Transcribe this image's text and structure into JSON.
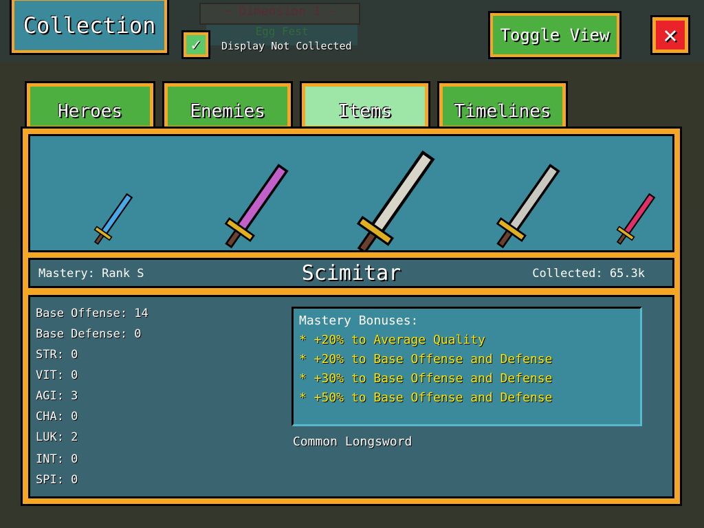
{
  "background": {
    "title": "~ Dimension 1 ~",
    "subtitle": "Egg Fest"
  },
  "header": {
    "title": "Collection",
    "checkbox_label": "Display Not Collected",
    "checkbox_checked": true,
    "toggle_label": "Toggle View",
    "close_icon": "close-x-icon"
  },
  "tabs": [
    {
      "label": "Heroes",
      "selected": false
    },
    {
      "label": "Enemies",
      "selected": false
    },
    {
      "label": "Items",
      "selected": true
    },
    {
      "label": "Timelines",
      "selected": false
    }
  ],
  "showcase": {
    "items": [
      {
        "name": "blue-dagger",
        "color": "#4aa8e8"
      },
      {
        "name": "pink-crystal-sword",
        "color": "#c060c8"
      },
      {
        "name": "scimitar",
        "color": "#d8d4c8"
      },
      {
        "name": "silver-sword",
        "color": "#c8c8c0"
      },
      {
        "name": "pink-rapier",
        "color": "#e0306a"
      }
    ]
  },
  "item": {
    "mastery": "Mastery: Rank S",
    "name": "Scimitar",
    "collected": "Collected: 65.3k",
    "type": "Common Longsword"
  },
  "stats": [
    "Base Offense: 14",
    "Base Defense: 0",
    "STR: 0",
    "VIT: 0",
    "AGI: 3",
    "CHA: 0",
    "LUK: 2",
    "INT: 0",
    "SPI: 0"
  ],
  "bonuses": {
    "title": "Mastery Bonuses:",
    "items": [
      "* +20% to Average Quality",
      "* +20% to Base Offense and Defense",
      "* +30% to Base Offense and Defense",
      "* +50% to Base Offense and Defense"
    ]
  },
  "colors": {
    "accent": "#f5a623",
    "tab": "#4caf3f",
    "tab_selected": "#9ee6a8",
    "bonus_text": "#ffe600"
  }
}
